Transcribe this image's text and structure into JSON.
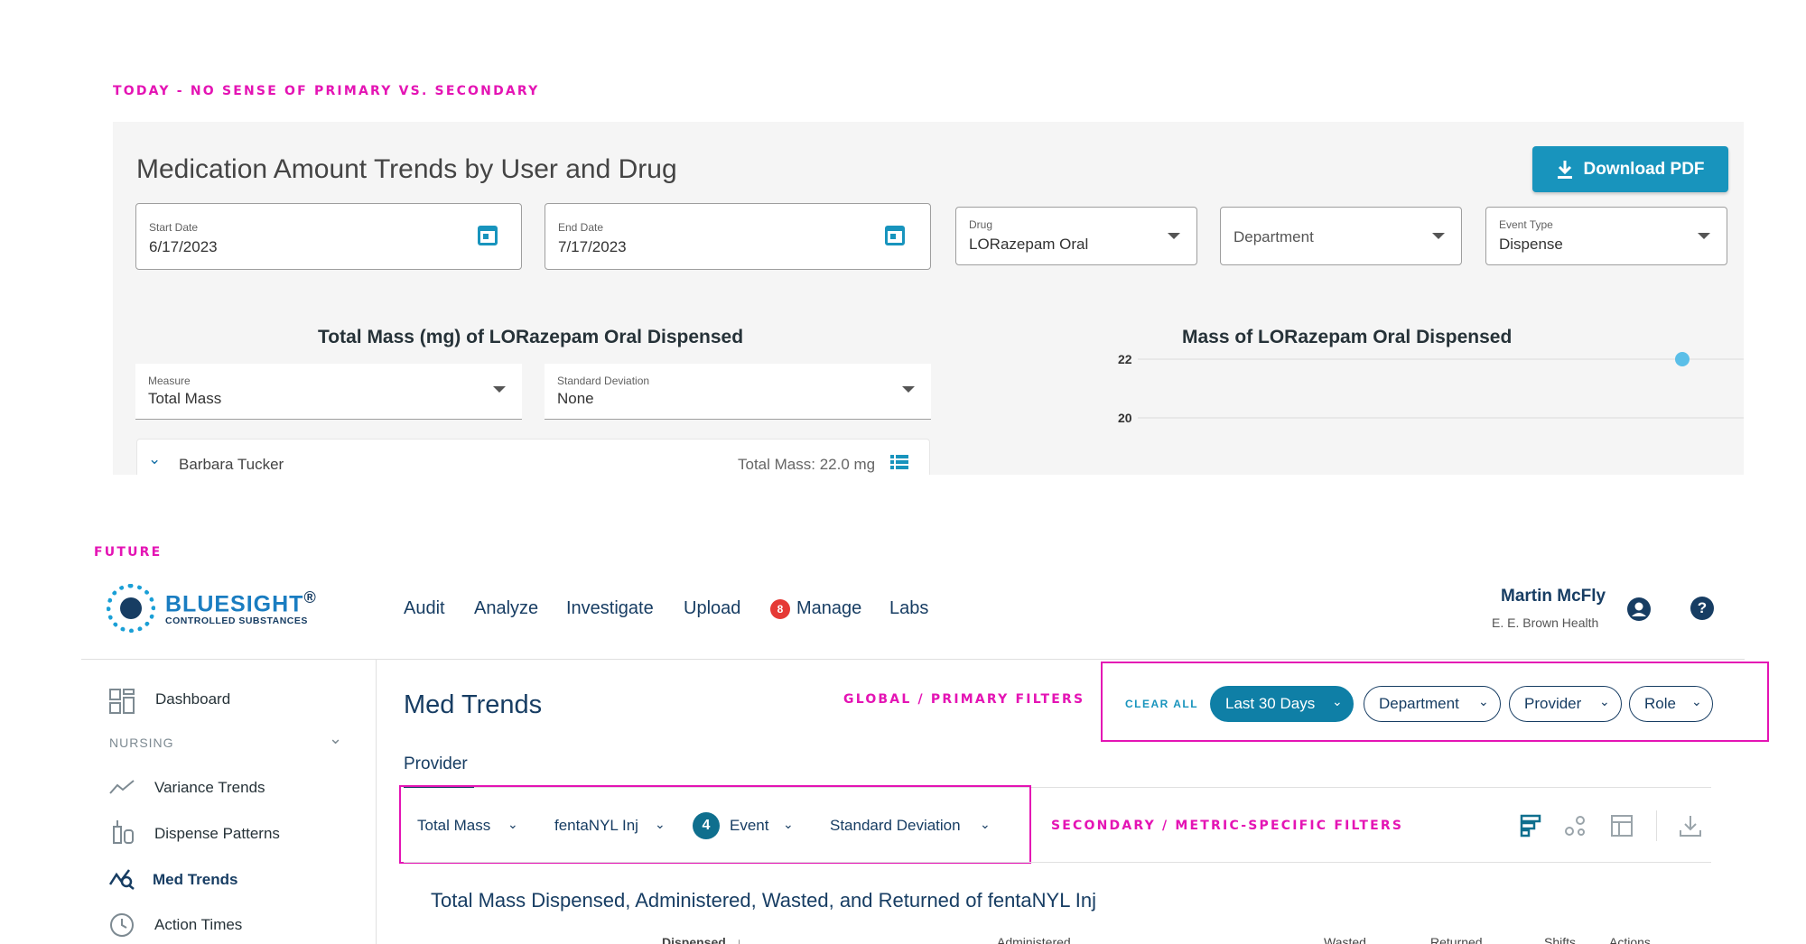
{
  "annotations": {
    "today": "TODAY - NO SENSE OF PRIMARY VS. SECONDARY",
    "future": "FUTURE",
    "global_filters": "GLOBAL / PRIMARY FILTERS",
    "secondary_filters": "SECONDARY / METRIC-SPECIFIC FILTERS",
    "color": "#e414b4"
  },
  "today": {
    "title": "Medication Amount Trends by User and Drug",
    "download_label": "Download PDF",
    "start_date": {
      "label": "Start Date",
      "value": "6/17/2023"
    },
    "end_date": {
      "label": "End Date",
      "value": "7/17/2023"
    },
    "drug": {
      "label": "Drug",
      "value": "LORazepam Oral"
    },
    "department": {
      "placeholder": "Department"
    },
    "event_type": {
      "label": "Event Type",
      "value": "Dispense"
    },
    "left_chart_title": "Total Mass (mg) of LORazepam Oral Dispensed",
    "measure": {
      "label": "Measure",
      "value": "Total Mass"
    },
    "std_dev": {
      "label": "Standard Deviation",
      "value": "None"
    },
    "user_row": {
      "name": "Barbara Tucker",
      "total": "Total Mass: 22.0 mg"
    },
    "right_chart_title": "Mass of LORazepam Oral Dispensed",
    "accent_color": "#1894bd"
  },
  "chart_data": {
    "type": "scatter",
    "title": "Mass of LORazepam Oral Dispensed",
    "y_ticks": [
      "22",
      "20"
    ],
    "points": [
      {
        "y": 22
      }
    ],
    "grid": true
  },
  "future": {
    "logo": {
      "name": "BLUESIGHT",
      "reg": "®",
      "sub": "CONTROLLED SUBSTANCES"
    },
    "nav": [
      "Audit",
      "Analyze",
      "Investigate",
      "Upload",
      "Manage",
      "Labs"
    ],
    "manage_badge": "8",
    "user": {
      "name": "Martin McFly",
      "org": "E. E. Brown Health",
      "help": "?"
    },
    "sidebar": {
      "dashboard": "Dashboard",
      "section": "NURSING",
      "items": [
        "Variance Trends",
        "Dispense Patterns",
        "Med Trends",
        "Action Times"
      ],
      "active": "Med Trends"
    },
    "page_title": "Med Trends",
    "tab": "Provider",
    "clear_all": "CLEAR ALL",
    "global_pills": [
      "Last 30 Days",
      "Department",
      "Provider",
      "Role"
    ],
    "secondary": {
      "measure": "Total Mass",
      "drug": "fentaNYL Inj",
      "event_count": "4",
      "event": "Event",
      "std_dev": "Standard Deviation"
    },
    "chart_title": "Total Mass Dispensed, Administered, Wasted, and Returned of fentaNYL Inj",
    "columns": [
      "Dispensed",
      "Administered",
      "Wasted",
      "Returned",
      "Shifts",
      "Actions"
    ],
    "sort_indicator": "↓",
    "brand_color": "#173d63"
  }
}
